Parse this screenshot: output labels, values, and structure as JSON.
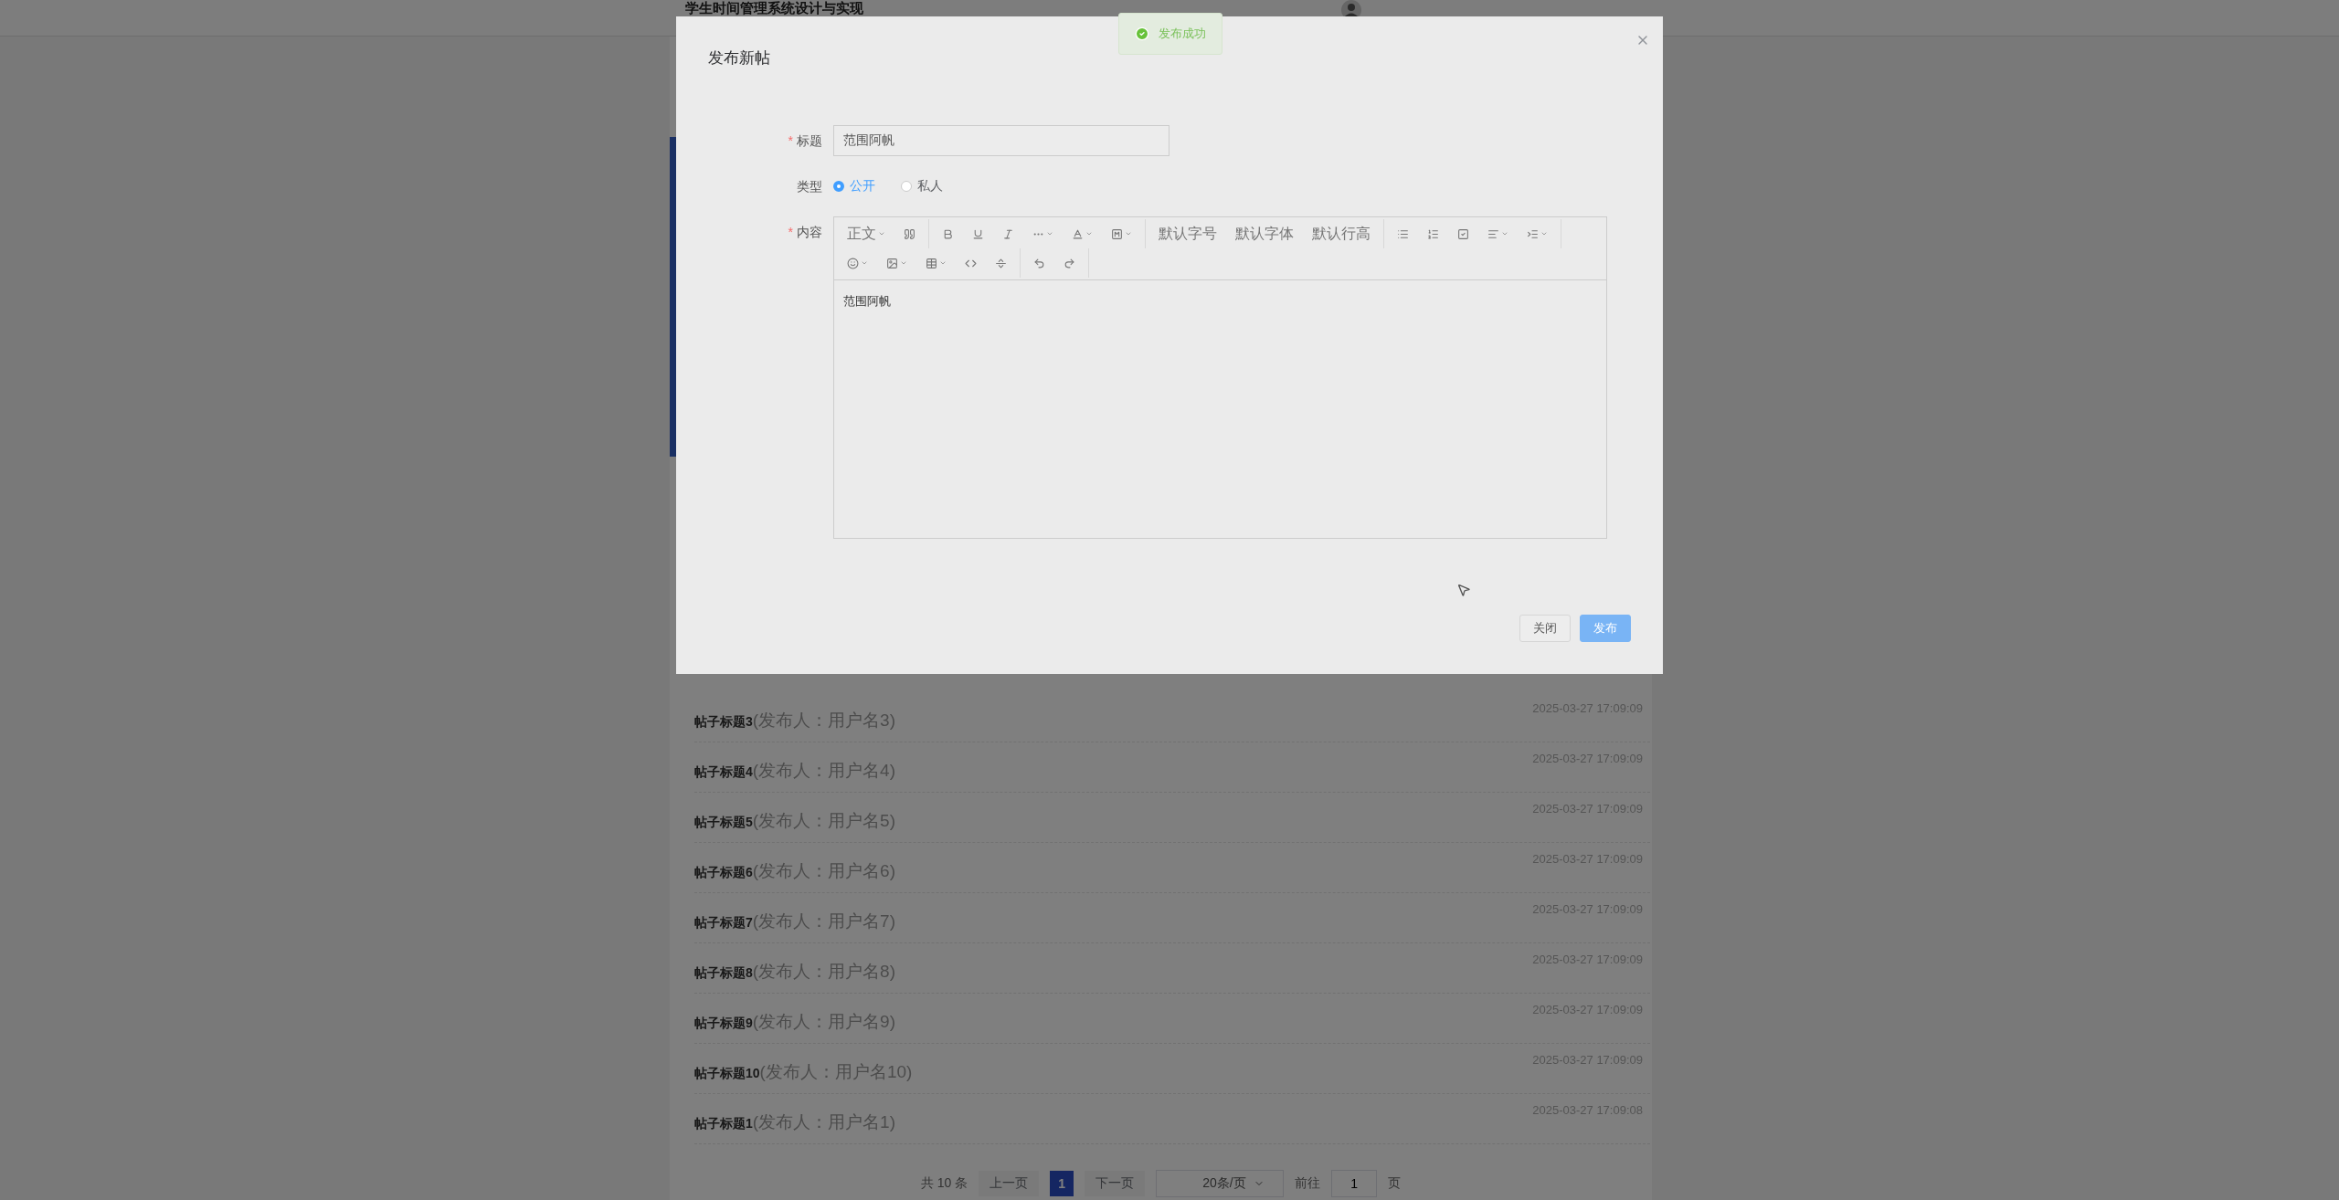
{
  "header": {
    "title": "学生时间管理系统设计与实现"
  },
  "posts": [
    {
      "title": "帖子标题3",
      "author": "(发布人：用户名3)",
      "time": "2025-03-27 17:09:09"
    },
    {
      "title": "帖子标题4",
      "author": "(发布人：用户名4)",
      "time": "2025-03-27 17:09:09"
    },
    {
      "title": "帖子标题5",
      "author": "(发布人：用户名5)",
      "time": "2025-03-27 17:09:09"
    },
    {
      "title": "帖子标题6",
      "author": "(发布人：用户名6)",
      "time": "2025-03-27 17:09:09"
    },
    {
      "title": "帖子标题7",
      "author": "(发布人：用户名7)",
      "time": "2025-03-27 17:09:09"
    },
    {
      "title": "帖子标题8",
      "author": "(发布人：用户名8)",
      "time": "2025-03-27 17:09:09"
    },
    {
      "title": "帖子标题9",
      "author": "(发布人：用户名9)",
      "time": "2025-03-27 17:09:09"
    },
    {
      "title": "帖子标题10",
      "author": "(发布人：用户名10)",
      "time": "2025-03-27 17:09:09"
    },
    {
      "title": "帖子标题1",
      "author": "(发布人：用户名1)",
      "time": "2025-03-27 17:09:08"
    }
  ],
  "pagination": {
    "total": "共 10 条",
    "prev": {
      "label": "上一页",
      "disabled": true
    },
    "pages": [
      {
        "label": "1",
        "selected": true
      }
    ],
    "next": {
      "label": "下一页",
      "disabled": true
    },
    "page_size": "20条/页",
    "goto_label": "前往",
    "goto_value": "1",
    "goto_suffix": "页"
  },
  "toast": {
    "message": "发布成功"
  },
  "dialog": {
    "title": "发布新帖",
    "fields": [
      {
        "kind": "text",
        "marker": "*",
        "label": "标题",
        "value": "范围阿帆"
      },
      {
        "kind": "radio",
        "label": "类型",
        "options": [
          {
            "label": "公开",
            "selected": true
          },
          {
            "label": "私人",
            "selected": false
          }
        ]
      },
      {
        "kind": "editor",
        "marker": "*",
        "label": "内容",
        "value": "范围阿帆",
        "toolbar": [
          [
            [
              {
                "kind": "label",
                "text": "正文",
                "dropdown": true
              },
              {
                "kind": "icon",
                "dropdown": false
              }
            ],
            [
              {
                "kind": "icon",
                "dropdown": false
              },
              {
                "kind": "icon",
                "dropdown": false
              },
              {
                "kind": "icon",
                "dropdown": false
              },
              {
                "kind": "icon",
                "dropdown": true
              },
              {
                "kind": "icon",
                "dropdown": true
              },
              {
                "kind": "icon",
                "dropdown": true
              }
            ],
            [
              {
                "kind": "label",
                "text": "默认字号",
                "dropdown": false
              },
              {
                "kind": "label",
                "text": "默认字体",
                "dropdown": false
              },
              {
                "kind": "label",
                "text": "默认行高",
                "dropdown": false
              }
            ],
            [
              {
                "kind": "icon",
                "dropdown": false
              },
              {
                "kind": "icon",
                "dropdown": false
              },
              {
                "kind": "icon",
                "dropdown": false
              },
              {
                "kind": "icon",
                "dropdown": true
              },
              {
                "kind": "icon",
                "dropdown": true
              }
            ]
          ],
          [
            [
              {
                "kind": "icon",
                "dropdown": true
              },
              {
                "kind": "icon",
                "dropdown": true
              },
              {
                "kind": "icon",
                "dropdown": true
              },
              {
                "kind": "icon",
                "dropdown": false
              },
              {
                "kind": "icon",
                "dropdown": false
              }
            ],
            [
              {
                "kind": "icon",
                "dropdown": false
              },
              {
                "kind": "icon",
                "dropdown": false
              }
            ]
          ]
        ]
      }
    ],
    "buttons": [
      {
        "kind": "default",
        "label": "关闭"
      },
      {
        "kind": "primary",
        "label": "发布"
      }
    ]
  }
}
